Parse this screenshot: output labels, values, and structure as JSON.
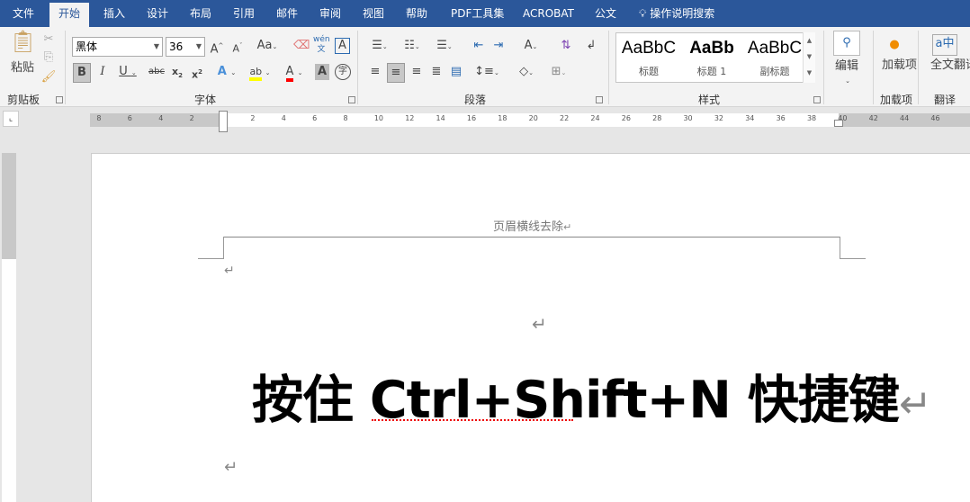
{
  "tabs": [
    "文件",
    "开始",
    "插入",
    "设计",
    "布局",
    "引用",
    "邮件",
    "审阅",
    "视图",
    "帮助",
    "PDF工具集",
    "ACROBAT",
    "公文"
  ],
  "active_tab": "开始",
  "tell_me": "操作说明搜索",
  "clipboard": {
    "paste": "粘贴",
    "label": "剪贴板"
  },
  "font": {
    "name": "黑体",
    "size": "36",
    "label": "字体"
  },
  "paragraph": {
    "label": "段落"
  },
  "styles": {
    "items": [
      "标题",
      "标题 1",
      "副标题"
    ],
    "preview": [
      "AaBbC",
      "AaBb",
      "AaBbC"
    ],
    "label": "样式"
  },
  "editing": {
    "label": "编辑"
  },
  "addins": {
    "button": "加载项",
    "label": "加载项"
  },
  "translate": {
    "button": "全文翻译",
    "label": "翻译"
  },
  "ruler": {
    "left": [
      "8",
      "6",
      "4",
      "2"
    ],
    "right": [
      "2",
      "4",
      "6",
      "8",
      "10",
      "12",
      "14",
      "16",
      "18",
      "20",
      "22",
      "24",
      "26",
      "28",
      "30",
      "32",
      "34",
      "36",
      "38",
      "40",
      "42",
      "44",
      "46"
    ]
  },
  "document": {
    "header": "页眉横线去除",
    "body": "按住 Ctrl+Shift+N 快捷键",
    "para_mark": "↵"
  },
  "colors": {
    "tab_bar": "#2b579a",
    "highlight": "#ffff00",
    "font_color": "#ff0000"
  }
}
